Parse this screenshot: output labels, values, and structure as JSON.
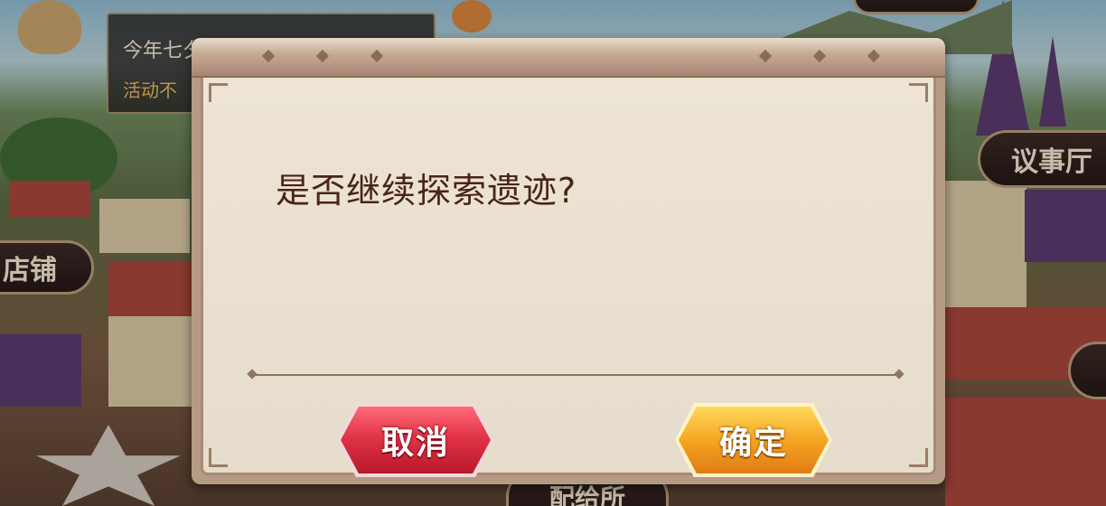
{
  "background": {
    "notice_line1": "今年七夕",
    "notice_line2": "活动不",
    "plaque_left": "店铺",
    "plaque_right": "议事厅",
    "plaque_bottom": "配给所"
  },
  "dialog": {
    "message": "是否继续探索遗迹?",
    "cancel_label": "取消",
    "confirm_label": "确定"
  },
  "colors": {
    "cancel_button": "#e23447",
    "confirm_button": "#f5a623",
    "dialog_background": "#ede4d5",
    "message_text": "#4a2418"
  }
}
